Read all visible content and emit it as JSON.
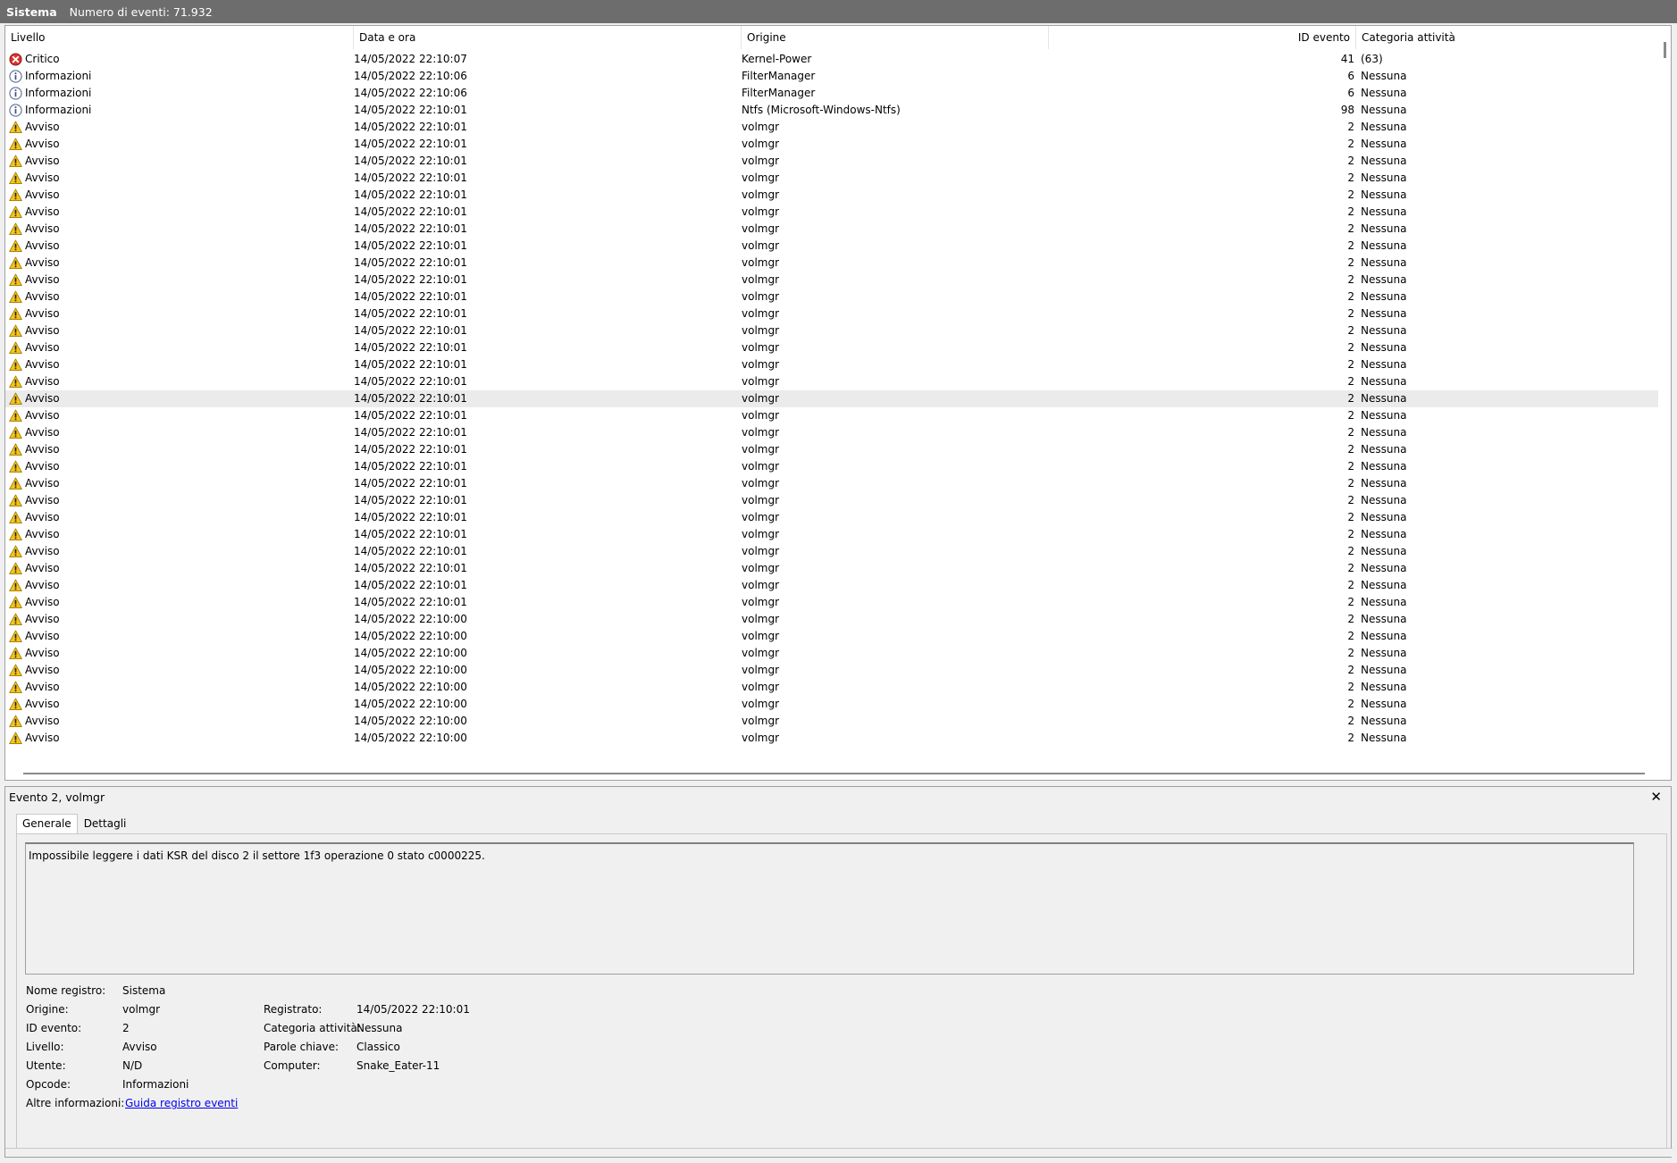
{
  "titlebar": {
    "name": "Sistema",
    "count_label": "Numero di eventi: 71.932"
  },
  "list": {
    "headers": {
      "level": "Livello",
      "date": "Data e ora",
      "source": "Origine",
      "id": "ID evento",
      "category": "Categoria attività"
    },
    "rows": [
      {
        "level": "Critico",
        "icon": "error-icon",
        "date": "14/05/2022 22:10:07",
        "source": "Kernel-Power",
        "id": "41",
        "category": "(63)"
      },
      {
        "level": "Informazioni",
        "icon": "info-icon",
        "date": "14/05/2022 22:10:06",
        "source": "FilterManager",
        "id": "6",
        "category": "Nessuna"
      },
      {
        "level": "Informazioni",
        "icon": "info-icon",
        "date": "14/05/2022 22:10:06",
        "source": "FilterManager",
        "id": "6",
        "category": "Nessuna"
      },
      {
        "level": "Informazioni",
        "icon": "info-icon",
        "date": "14/05/2022 22:10:01",
        "source": "Ntfs (Microsoft-Windows-Ntfs)",
        "id": "98",
        "category": "Nessuna"
      },
      {
        "level": "Avviso",
        "icon": "warning-icon",
        "date": "14/05/2022 22:10:01",
        "source": "volmgr",
        "id": "2",
        "category": "Nessuna"
      },
      {
        "level": "Avviso",
        "icon": "warning-icon",
        "date": "14/05/2022 22:10:01",
        "source": "volmgr",
        "id": "2",
        "category": "Nessuna"
      },
      {
        "level": "Avviso",
        "icon": "warning-icon",
        "date": "14/05/2022 22:10:01",
        "source": "volmgr",
        "id": "2",
        "category": "Nessuna"
      },
      {
        "level": "Avviso",
        "icon": "warning-icon",
        "date": "14/05/2022 22:10:01",
        "source": "volmgr",
        "id": "2",
        "category": "Nessuna"
      },
      {
        "level": "Avviso",
        "icon": "warning-icon",
        "date": "14/05/2022 22:10:01",
        "source": "volmgr",
        "id": "2",
        "category": "Nessuna"
      },
      {
        "level": "Avviso",
        "icon": "warning-icon",
        "date": "14/05/2022 22:10:01",
        "source": "volmgr",
        "id": "2",
        "category": "Nessuna"
      },
      {
        "level": "Avviso",
        "icon": "warning-icon",
        "date": "14/05/2022 22:10:01",
        "source": "volmgr",
        "id": "2",
        "category": "Nessuna"
      },
      {
        "level": "Avviso",
        "icon": "warning-icon",
        "date": "14/05/2022 22:10:01",
        "source": "volmgr",
        "id": "2",
        "category": "Nessuna"
      },
      {
        "level": "Avviso",
        "icon": "warning-icon",
        "date": "14/05/2022 22:10:01",
        "source": "volmgr",
        "id": "2",
        "category": "Nessuna"
      },
      {
        "level": "Avviso",
        "icon": "warning-icon",
        "date": "14/05/2022 22:10:01",
        "source": "volmgr",
        "id": "2",
        "category": "Nessuna"
      },
      {
        "level": "Avviso",
        "icon": "warning-icon",
        "date": "14/05/2022 22:10:01",
        "source": "volmgr",
        "id": "2",
        "category": "Nessuna"
      },
      {
        "level": "Avviso",
        "icon": "warning-icon",
        "date": "14/05/2022 22:10:01",
        "source": "volmgr",
        "id": "2",
        "category": "Nessuna"
      },
      {
        "level": "Avviso",
        "icon": "warning-icon",
        "date": "14/05/2022 22:10:01",
        "source": "volmgr",
        "id": "2",
        "category": "Nessuna"
      },
      {
        "level": "Avviso",
        "icon": "warning-icon",
        "date": "14/05/2022 22:10:01",
        "source": "volmgr",
        "id": "2",
        "category": "Nessuna"
      },
      {
        "level": "Avviso",
        "icon": "warning-icon",
        "date": "14/05/2022 22:10:01",
        "source": "volmgr",
        "id": "2",
        "category": "Nessuna"
      },
      {
        "level": "Avviso",
        "icon": "warning-icon",
        "date": "14/05/2022 22:10:01",
        "source": "volmgr",
        "id": "2",
        "category": "Nessuna"
      },
      {
        "level": "Avviso",
        "icon": "warning-icon",
        "date": "14/05/2022 22:10:01",
        "source": "volmgr",
        "id": "2",
        "category": "Nessuna",
        "selected": true
      },
      {
        "level": "Avviso",
        "icon": "warning-icon",
        "date": "14/05/2022 22:10:01",
        "source": "volmgr",
        "id": "2",
        "category": "Nessuna"
      },
      {
        "level": "Avviso",
        "icon": "warning-icon",
        "date": "14/05/2022 22:10:01",
        "source": "volmgr",
        "id": "2",
        "category": "Nessuna"
      },
      {
        "level": "Avviso",
        "icon": "warning-icon",
        "date": "14/05/2022 22:10:01",
        "source": "volmgr",
        "id": "2",
        "category": "Nessuna"
      },
      {
        "level": "Avviso",
        "icon": "warning-icon",
        "date": "14/05/2022 22:10:01",
        "source": "volmgr",
        "id": "2",
        "category": "Nessuna"
      },
      {
        "level": "Avviso",
        "icon": "warning-icon",
        "date": "14/05/2022 22:10:01",
        "source": "volmgr",
        "id": "2",
        "category": "Nessuna"
      },
      {
        "level": "Avviso",
        "icon": "warning-icon",
        "date": "14/05/2022 22:10:01",
        "source": "volmgr",
        "id": "2",
        "category": "Nessuna"
      },
      {
        "level": "Avviso",
        "icon": "warning-icon",
        "date": "14/05/2022 22:10:01",
        "source": "volmgr",
        "id": "2",
        "category": "Nessuna"
      },
      {
        "level": "Avviso",
        "icon": "warning-icon",
        "date": "14/05/2022 22:10:01",
        "source": "volmgr",
        "id": "2",
        "category": "Nessuna"
      },
      {
        "level": "Avviso",
        "icon": "warning-icon",
        "date": "14/05/2022 22:10:01",
        "source": "volmgr",
        "id": "2",
        "category": "Nessuna"
      },
      {
        "level": "Avviso",
        "icon": "warning-icon",
        "date": "14/05/2022 22:10:01",
        "source": "volmgr",
        "id": "2",
        "category": "Nessuna"
      },
      {
        "level": "Avviso",
        "icon": "warning-icon",
        "date": "14/05/2022 22:10:01",
        "source": "volmgr",
        "id": "2",
        "category": "Nessuna"
      },
      {
        "level": "Avviso",
        "icon": "warning-icon",
        "date": "14/05/2022 22:10:01",
        "source": "volmgr",
        "id": "2",
        "category": "Nessuna"
      },
      {
        "level": "Avviso",
        "icon": "warning-icon",
        "date": "14/05/2022 22:10:00",
        "source": "volmgr",
        "id": "2",
        "category": "Nessuna"
      },
      {
        "level": "Avviso",
        "icon": "warning-icon",
        "date": "14/05/2022 22:10:00",
        "source": "volmgr",
        "id": "2",
        "category": "Nessuna"
      },
      {
        "level": "Avviso",
        "icon": "warning-icon",
        "date": "14/05/2022 22:10:00",
        "source": "volmgr",
        "id": "2",
        "category": "Nessuna"
      },
      {
        "level": "Avviso",
        "icon": "warning-icon",
        "date": "14/05/2022 22:10:00",
        "source": "volmgr",
        "id": "2",
        "category": "Nessuna"
      },
      {
        "level": "Avviso",
        "icon": "warning-icon",
        "date": "14/05/2022 22:10:00",
        "source": "volmgr",
        "id": "2",
        "category": "Nessuna"
      },
      {
        "level": "Avviso",
        "icon": "warning-icon",
        "date": "14/05/2022 22:10:00",
        "source": "volmgr",
        "id": "2",
        "category": "Nessuna"
      },
      {
        "level": "Avviso",
        "icon": "warning-icon",
        "date": "14/05/2022 22:10:00",
        "source": "volmgr",
        "id": "2",
        "category": "Nessuna"
      },
      {
        "level": "Avviso",
        "icon": "warning-icon",
        "date": "14/05/2022 22:10:00",
        "source": "volmgr",
        "id": "2",
        "category": "Nessuna"
      }
    ]
  },
  "detail": {
    "title": "Evento 2, volmgr",
    "close_glyph": "✕",
    "tabs": [
      "Generale",
      "Dettagli"
    ],
    "description": "Impossibile leggere i dati KSR del disco 2 il settore 1f3 operazione 0 stato c0000225.",
    "left": [
      {
        "label": "Nome registro:",
        "value": "Sistema"
      },
      {
        "label": "Origine:",
        "value": "volmgr"
      },
      {
        "label": "ID evento:",
        "value": "2"
      },
      {
        "label": "Livello:",
        "value": "Avviso"
      },
      {
        "label": "Utente:",
        "value": "N/D"
      },
      {
        "label": "Opcode:",
        "value": "Informazioni"
      },
      {
        "label": "Altre informazioni:",
        "value": "Guida registro eventi",
        "link": true
      }
    ],
    "right": [
      {
        "label": "Registrato:",
        "value": "14/05/2022 22:10:01"
      },
      {
        "label": "Categoria attività:",
        "value": "Nessuna"
      },
      {
        "label": "Parole chiave:",
        "value": "Classico"
      },
      {
        "label": "Computer:",
        "value": "Snake_Eater-11"
      }
    ]
  },
  "colors": {
    "titlebar": "#6d6d6d",
    "selected_row": "#ebebeb",
    "link": "#0000ee",
    "warning": "#f5c518",
    "error": "#d9342b",
    "info": "#5a6f99"
  }
}
